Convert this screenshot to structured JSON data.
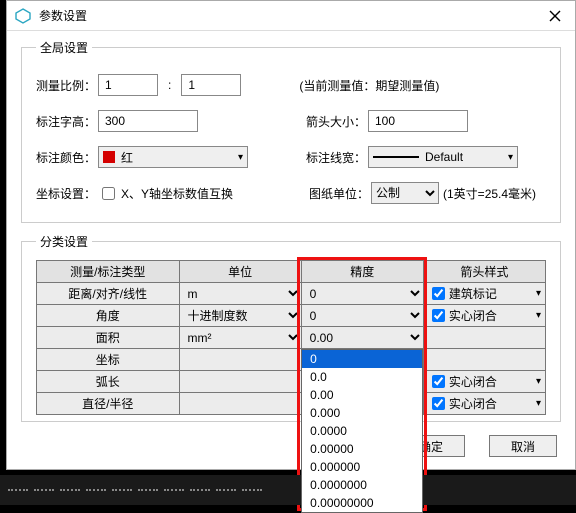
{
  "window": {
    "title": "参数设置"
  },
  "global": {
    "legend": "全局设置",
    "ratio_label": "测量比例：",
    "ratio_a": "1",
    "ratio_b": "1",
    "ratio_hint": "(当前测量值：期望测量值)",
    "textheight_label": "标注字高：",
    "textheight": "300",
    "arrowsize_label": "箭头大小：",
    "arrowsize": "100",
    "color_label": "标注颜色：",
    "color_name": "红",
    "color_hex": "#d40000",
    "lineweight_label": "标注线宽：",
    "lineweight_name": "Default",
    "coord_label": "坐标设置：",
    "coord_swap_cb": "X、Y轴坐标数值互换",
    "unit_label": "图纸单位：",
    "unit_value": "公制",
    "unit_hint": "(1英寸=25.4毫米)"
  },
  "classify": {
    "legend": "分类设置",
    "headers": [
      "测量/标注类型",
      "单位",
      "精度",
      "箭头样式"
    ],
    "rows": [
      {
        "type": "距离/对齐/线性",
        "unit": "m",
        "precision": "0",
        "arrow": "建筑标记"
      },
      {
        "type": "角度",
        "unit": "十进制度数",
        "precision": "0",
        "arrow": "实心闭合"
      },
      {
        "type": "面积",
        "unit": "mm²",
        "precision": "0.00",
        "arrow": ""
      },
      {
        "type": "坐标",
        "unit": "",
        "precision": "",
        "arrow": ""
      },
      {
        "type": "弧长",
        "unit": "",
        "precision": "",
        "arrow": "实心闭合"
      },
      {
        "type": "直径/半径",
        "unit": "",
        "precision": "",
        "arrow": "实心闭合"
      }
    ],
    "open_dropdown_options": [
      "0",
      "0.0",
      "0.00",
      "0.000",
      "0.0000",
      "0.00000",
      "0.000000",
      "0.0000000",
      "0.00000000"
    ],
    "open_dropdown_selected": "0"
  },
  "buttons": {
    "ok": "确定",
    "cancel": "取消"
  }
}
